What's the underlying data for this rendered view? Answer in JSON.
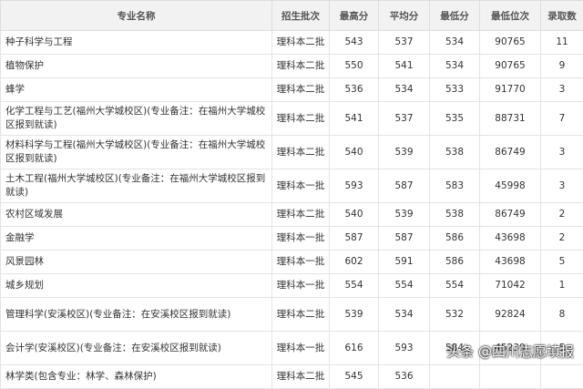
{
  "headers": [
    "专业名称",
    "招生批次",
    "最高分",
    "平均分",
    "最低分",
    "最低位次",
    "录取数"
  ],
  "rows": [
    [
      "种子科学与工程",
      "理科本二批",
      "543",
      "537",
      "534",
      "90765",
      "11"
    ],
    [
      "植物保护",
      "理科本二批",
      "550",
      "541",
      "534",
      "90765",
      "9"
    ],
    [
      "蜂学",
      "理科本二批",
      "536",
      "534",
      "533",
      "91770",
      "3"
    ],
    [
      "化学工程与工艺(福州大学城校区)(专业备注：在福州大学城校区报到就读)",
      "理科本二批",
      "541",
      "537",
      "535",
      "88731",
      "7"
    ],
    [
      "材料科学与工程(福州大学城校区)(专业备注：在福州大学城校区报到就读)",
      "理科本二批",
      "540",
      "539",
      "538",
      "86749",
      "3"
    ],
    [
      "土木工程(福州大学城校区)(专业备注：在福州大学城校区报到就读)",
      "理科本一批",
      "593",
      "587",
      "583",
      "45998",
      "3"
    ],
    [
      "农村区域发展",
      "理科本二批",
      "540",
      "539",
      "538",
      "86749",
      "2"
    ],
    [
      "金融学",
      "理科本一批",
      "587",
      "587",
      "586",
      "43698",
      "2"
    ],
    [
      "风景园林",
      "理科本一批",
      "602",
      "591",
      "586",
      "43698",
      "5"
    ],
    [
      "城乡规划",
      "理科本一批",
      "554",
      "554",
      "554",
      "71042",
      "1"
    ],
    [
      "管理科学(安溪校区)(专业备注：在安溪校区报到就读)",
      "理科本二批",
      "539",
      "534",
      "532",
      "92824",
      "8"
    ],
    [
      "会计学(安溪校区)(专业备注：在安溪校区报到就读)",
      "理科本一批",
      "616",
      "593",
      "584",
      "45239",
      "5"
    ],
    [
      "林学类(包含专业：林学、森林保护)",
      "理科本二批",
      "545",
      "536",
      "",
      ""
    ]
  ],
  "watermark": "头条 @四川志愿填报"
}
